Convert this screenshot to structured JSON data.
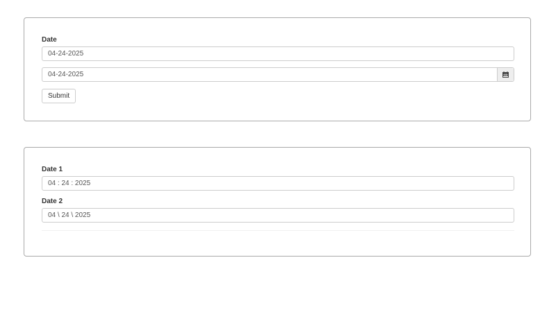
{
  "form1": {
    "date_label": "Date",
    "date_input_value": "04-24-2025",
    "date_picker_value": "04-24-2025",
    "calendar_icon": "calendar-icon",
    "submit_label": "Submit"
  },
  "form2": {
    "date1_label": "Date 1",
    "date1_value": "04 : 24 : 2025",
    "date2_label": "Date 2",
    "date2_value": "04 \\ 24 \\ 2025"
  }
}
